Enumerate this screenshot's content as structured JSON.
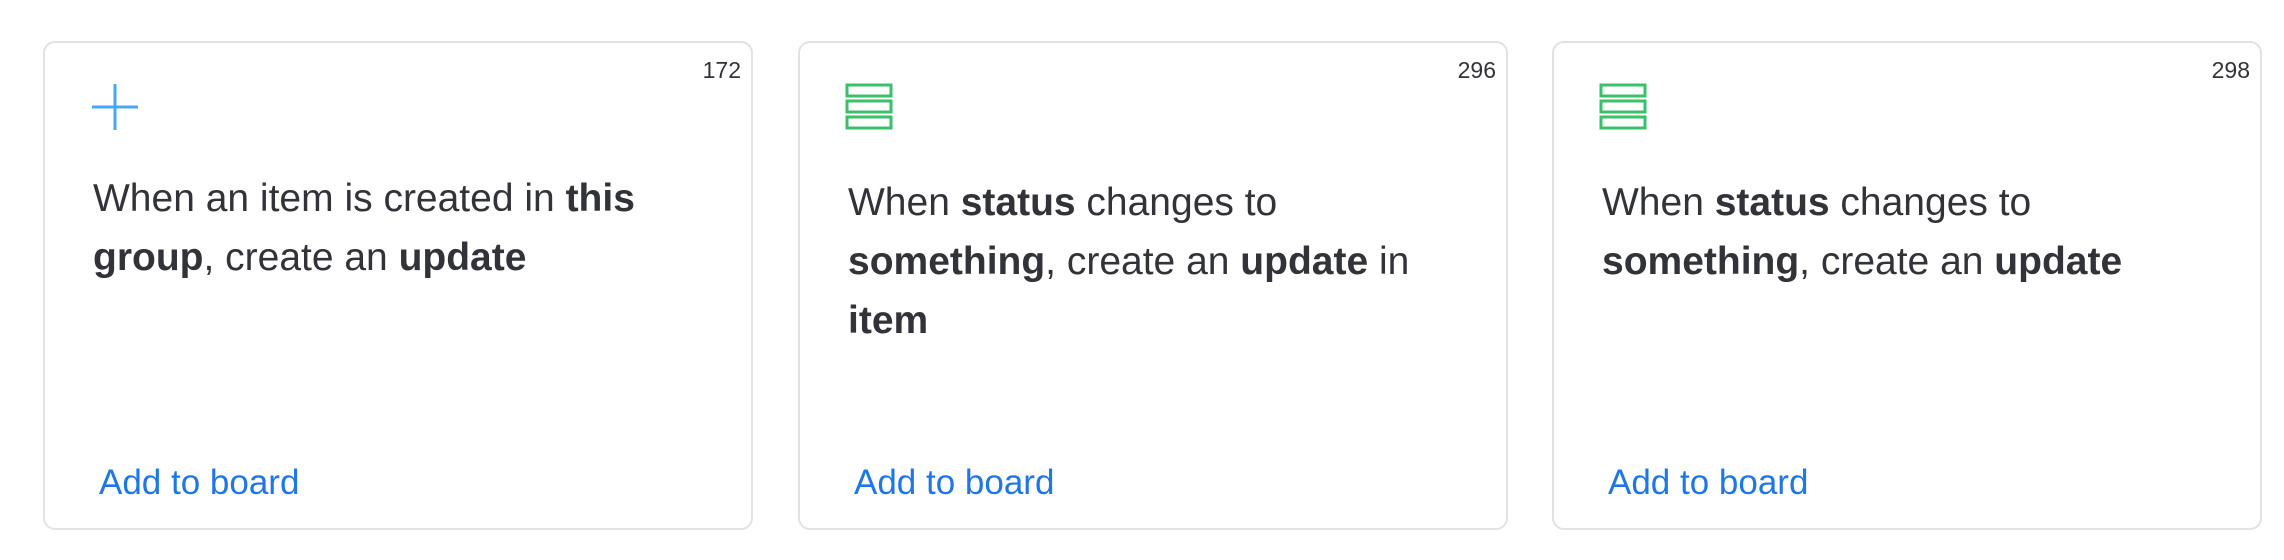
{
  "cards": [
    {
      "count": "172",
      "icon": "plus-icon",
      "icon_color": "#46a8f0",
      "sentence": {
        "p1": "When an item is created in ",
        "b1": "this group",
        "p2": ", create an ",
        "b2": "update"
      },
      "link": "Add to board"
    },
    {
      "count": "296",
      "icon": "columns-icon",
      "icon_color": "#3cbf6b",
      "sentence": {
        "p1": "When ",
        "b1": "status",
        "p2": " changes to ",
        "b2": "something",
        "p3": ", create an ",
        "b3": "update",
        "p4": " in ",
        "b4": "item"
      },
      "link": "Add to board"
    },
    {
      "count": "298",
      "icon": "columns-icon",
      "icon_color": "#3cbf6b",
      "sentence": {
        "p1": "When ",
        "b1": "status",
        "p2": " changes to ",
        "b2": "something",
        "p3": ", create an ",
        "b3": "update"
      },
      "link": "Add to board"
    }
  ],
  "colors": {
    "text": "#323338",
    "link": "#1f76e6",
    "border": "#e2e2e2"
  }
}
